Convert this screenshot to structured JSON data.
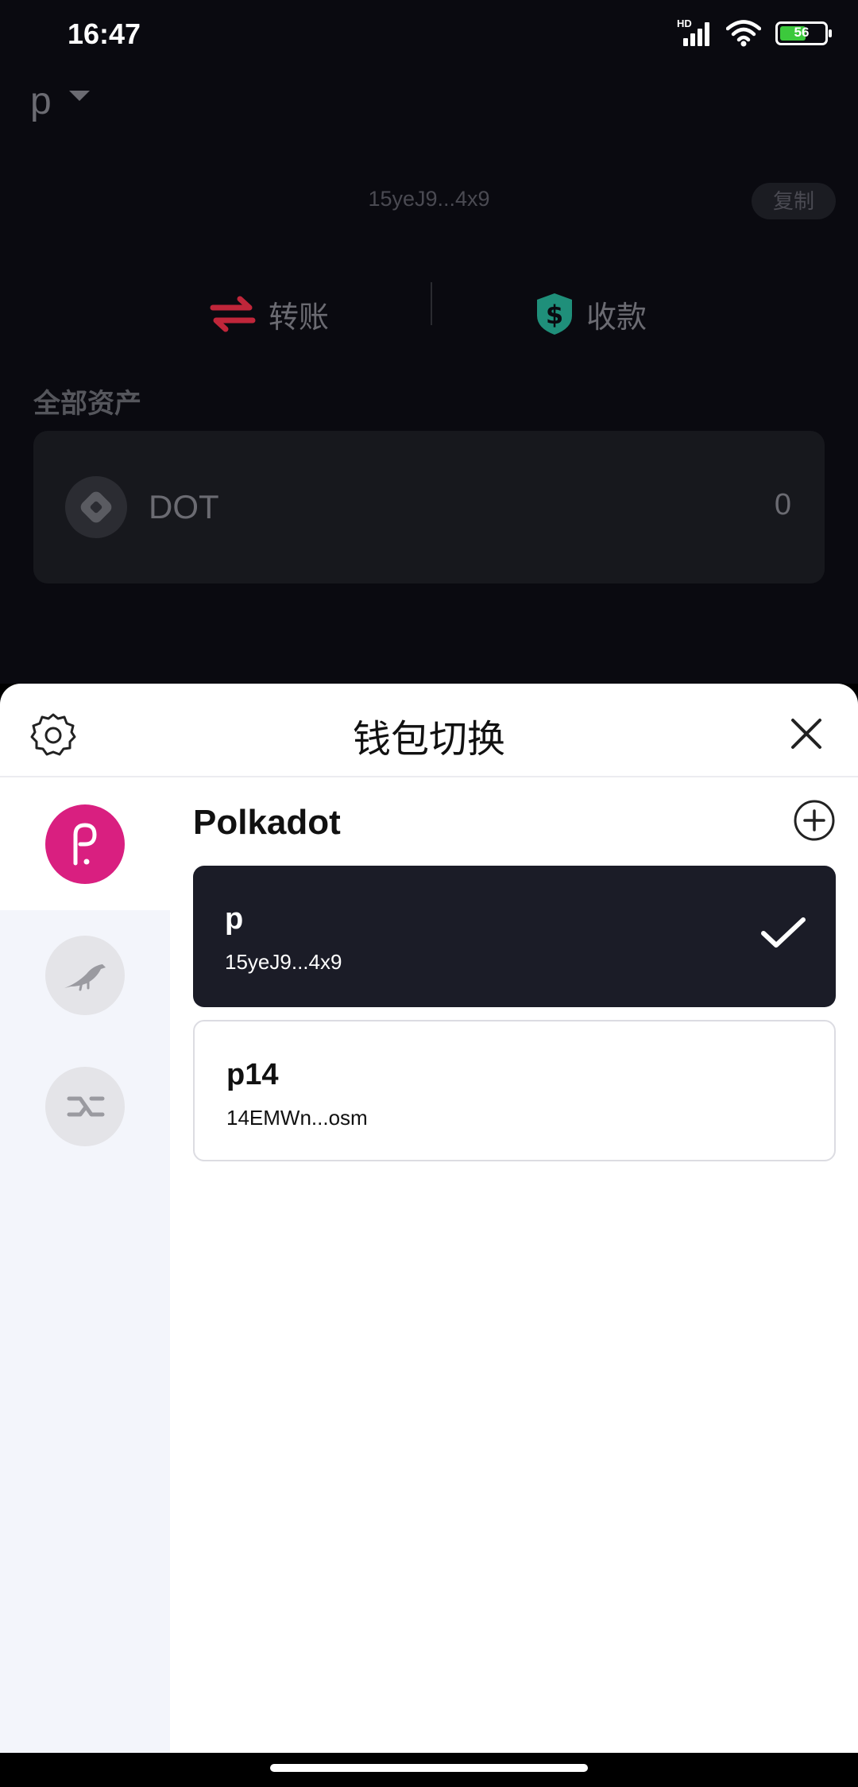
{
  "status_bar": {
    "time": "16:47",
    "network_label": "HD",
    "battery_level": "56"
  },
  "wallet_header": {
    "wallet_name": "p",
    "address": "15yeJ9...4x9",
    "copy_label": "复制"
  },
  "actions": {
    "transfer_label": "转账",
    "receive_label": "收款"
  },
  "assets": {
    "section_title": "全部资产",
    "items": [
      {
        "symbol": "DOT",
        "amount": "0"
      }
    ]
  },
  "wallet_switch_sheet": {
    "title": "钱包切换",
    "chains": [
      {
        "icon": "polkadot-logo-icon",
        "active": true
      },
      {
        "icon": "kusama-bird-icon",
        "active": false
      },
      {
        "icon": "swap-chain-icon",
        "active": false
      }
    ],
    "network_name": "Polkadot",
    "accounts": [
      {
        "name": "p",
        "address": "15yeJ9...4x9",
        "selected": true
      },
      {
        "name": "p14",
        "address": "14EMWn...osm",
        "selected": false
      }
    ]
  },
  "colors": {
    "polkadot_brand": "#d91f80",
    "selected_card": "#1b1c27",
    "transfer_icon": "#c0263a",
    "receive_icon": "#1f8f7a"
  }
}
